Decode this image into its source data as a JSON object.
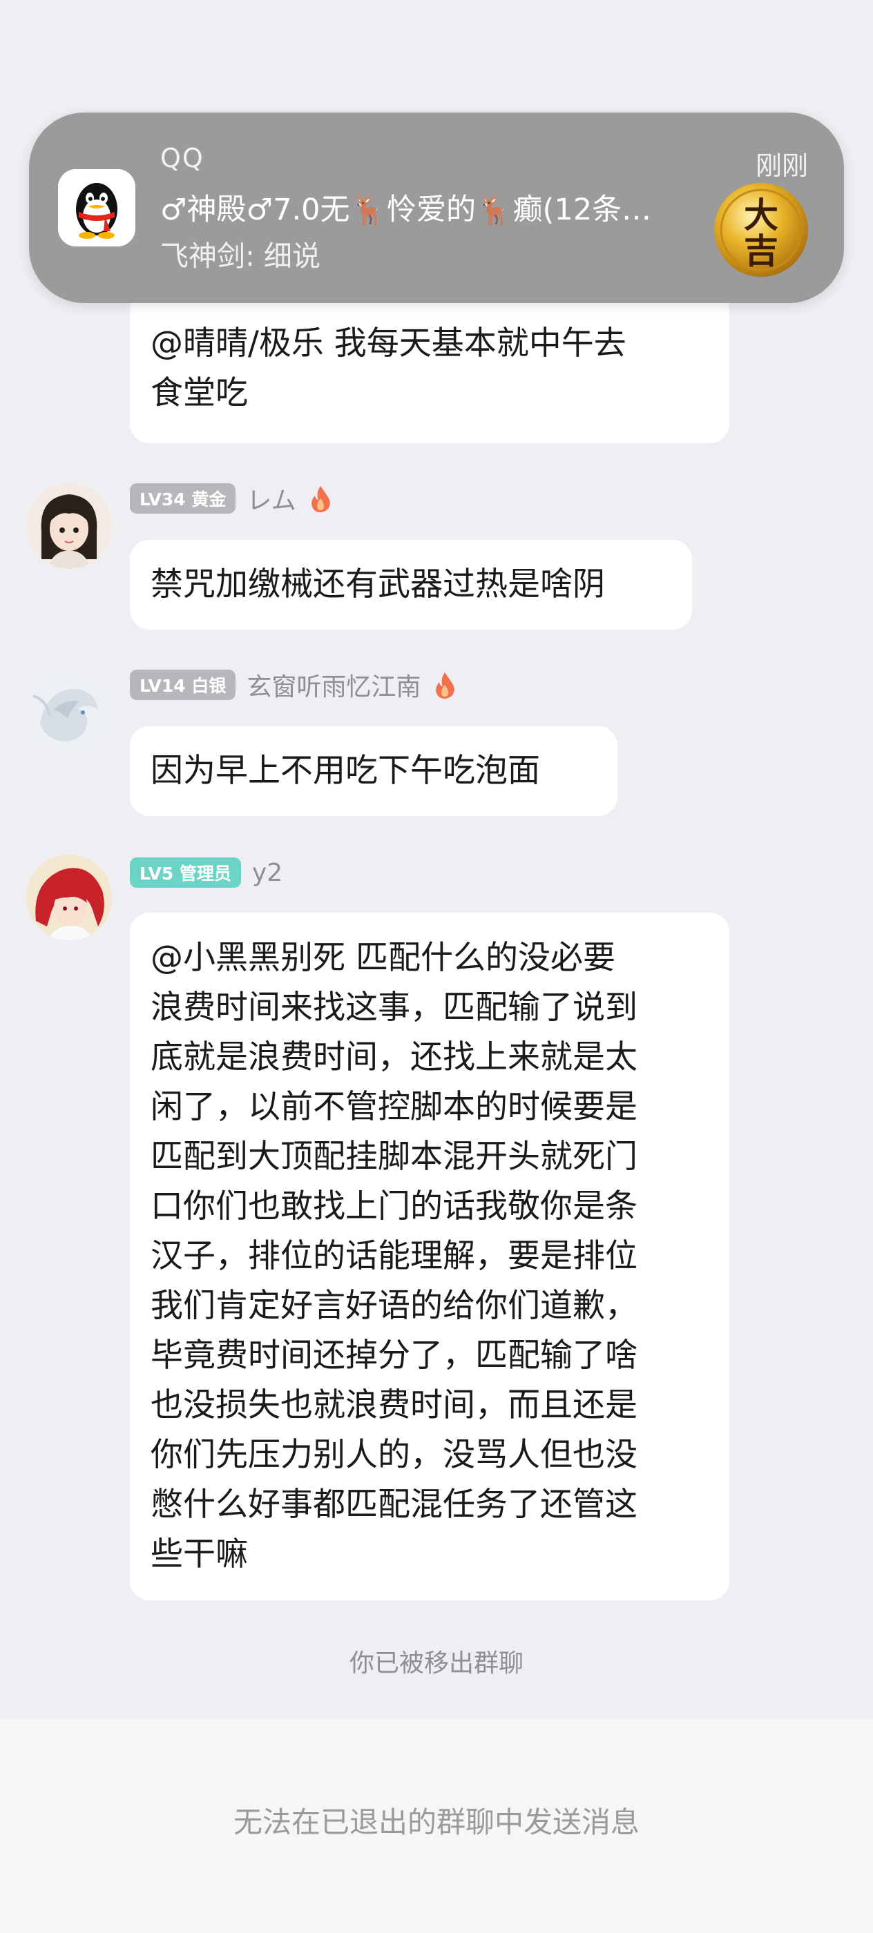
{
  "notification": {
    "app_name": "QQ",
    "time": "刚刚",
    "title": "♂神殿♂7.0无🦌怜爱的🦌癫(12条…",
    "subtitle": "飞神剑: 细说",
    "seal_text_top": "大",
    "seal_text_bottom": "吉",
    "colors": {
      "background": "#9b9b9b",
      "seal": "#d8a21c"
    }
  },
  "messages": [
    {
      "id": "msg-partial",
      "lines": [
        "@晴晴/极乐 我每天基本就中午去",
        "食堂吃"
      ]
    },
    {
      "id": "msg-rem",
      "badge": "LV34 黄金",
      "nickname": "レム",
      "has_flame": true,
      "lines": [
        "禁咒加缴械还有武器过热是啥阴"
      ]
    },
    {
      "id": "msg-xuanchuang",
      "badge": "LV14 白银",
      "nickname": "玄窗听雨忆江南",
      "has_flame": true,
      "lines": [
        "因为早上不用吃下午吃泡面"
      ]
    },
    {
      "id": "msg-y2",
      "badge": "LV5 管理员",
      "nickname": "y2",
      "has_flame": false,
      "lines": [
        "@小黑黑别死 匹配什么的没必要",
        "浪费时间来找这事，匹配输了说到",
        "底就是浪费时间，还找上来就是太",
        "闲了，以前不管控脚本的时候要是",
        "匹配到大顶配挂脚本混开头就死门",
        "口你们也敢找上门的话我敬你是条",
        "汉子，排位的话能理解，要是排位",
        "我们肯定好言好语的给你们道歉，",
        "毕竟费时间还掉分了，匹配输了啥",
        "也没损失也就浪费时间，而且还是",
        "你们先压力别人的，没骂人但也没",
        "憋什么好事都匹配混任务了还管这",
        "些干嘛"
      ]
    }
  ],
  "system_message": "你已被移出群聊",
  "input_disabled_hint": "无法在已退出的群聊中发送消息",
  "colors": {
    "chat_background": "#efeff3",
    "badge_grey": "#b7b7bb",
    "badge_admin": "#6cd3c7",
    "bubble": "#ffffff"
  }
}
